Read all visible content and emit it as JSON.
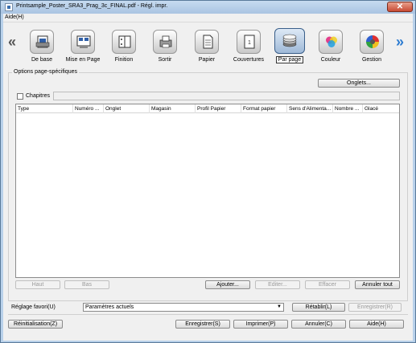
{
  "window": {
    "title": "Printsample_Poster_SRA3_Prag_3c_FINAL.pdf - Régl. impr.",
    "close_glyph": "✕"
  },
  "menu": {
    "help": "Aide(H)"
  },
  "toolbar": {
    "prev_glyph": "«",
    "next_glyph": "»",
    "items": [
      {
        "label": "De base",
        "icon": "basic-icon",
        "selected": false
      },
      {
        "label": "Mise en Page",
        "icon": "layout-icon",
        "selected": false
      },
      {
        "label": "Finition",
        "icon": "finishing-icon",
        "selected": false
      },
      {
        "label": "Sortir",
        "icon": "output-icon",
        "selected": false
      },
      {
        "label": "Papier",
        "icon": "paper-icon",
        "selected": false
      },
      {
        "label": "Couvertures",
        "icon": "covers-icon",
        "selected": false
      },
      {
        "label": "Par page",
        "icon": "per-page-icon",
        "selected": true
      },
      {
        "label": "Couleur",
        "icon": "color-icon",
        "selected": false
      },
      {
        "label": "Gestion",
        "icon": "management-icon",
        "selected": false
      }
    ]
  },
  "page_options": {
    "group_label": "Options page-spécifiques",
    "tabs_button": "Onglets...",
    "chapters_label": "Chapitres",
    "chapters_checked": false,
    "columns": [
      "Type",
      "Numéro ...",
      "Onglet",
      "Magasin",
      "Profil Papier",
      "Format papier",
      "Sens d'Alimenta...",
      "Nombre ...",
      "Glacé"
    ],
    "rows": [],
    "buttons": {
      "up": "Haut",
      "down": "Bas",
      "add": "Ajouter...",
      "edit": "Editer...",
      "delete": "Effacer",
      "cancel_all": "Annuler tout"
    }
  },
  "favorites": {
    "label": "Réglage favori(U)",
    "value": "Paramètres actuels",
    "restore": "Rétablir(L)",
    "save": "Enregistrer(R)"
  },
  "footer": {
    "reset": "Réinitialisation(Z)",
    "save": "Enregistrer(S)",
    "print": "Imprimer(P)",
    "cancel": "Annuler(C)",
    "help": "Aide(H)"
  },
  "colors": {
    "title_bar": "#b9d1ea",
    "selected_tab": "#9fb9d8",
    "close_button": "#c74a34"
  }
}
